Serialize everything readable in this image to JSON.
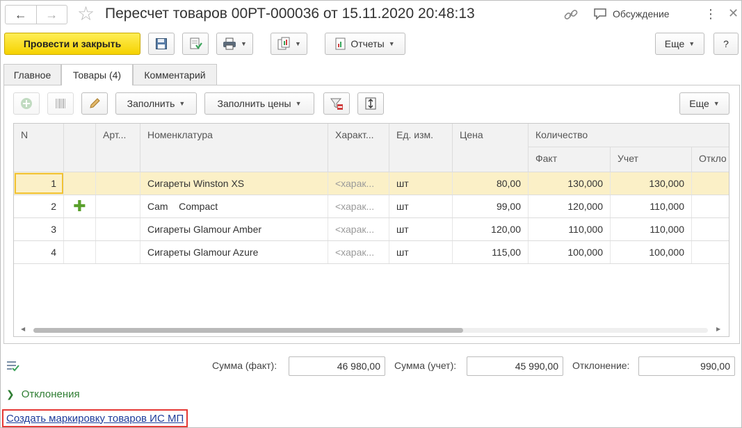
{
  "window": {
    "title": "Пересчет товаров 00РТ-000036 от 15.11.2020 20:48:13",
    "discussion_label": "Обсуждение"
  },
  "toolbar": {
    "post_close_label": "Провести и закрыть",
    "reports_label": "Отчеты",
    "more_label": "Еще",
    "help_label": "?"
  },
  "tabs": [
    {
      "label": "Главное",
      "active": false
    },
    {
      "label": "Товары (4)",
      "active": true
    },
    {
      "label": "Комментарий",
      "active": false
    }
  ],
  "items_toolbar": {
    "fill_label": "Заполнить",
    "fill_prices_label": "Заполнить цены",
    "more_label": "Еще"
  },
  "table": {
    "headers": {
      "n": "N",
      "article": "Арт...",
      "nomenclature": "Номенклатура",
      "characteristic": "Характ...",
      "unit": "Ед. изм.",
      "price": "Цена",
      "quantity": "Количество",
      "fact": "Факт",
      "account": "Учет",
      "deviation": "Откло"
    },
    "rows": [
      {
        "n": "1",
        "nomenclature": "Сигареты Winston XS",
        "characteristic": "<харак...",
        "unit": "шт",
        "price": "80,00",
        "fact": "130,000",
        "account": "130,000",
        "deviation": "",
        "added": false
      },
      {
        "n": "2",
        "nomenclature": "Cam    Compact",
        "characteristic": "<харак...",
        "unit": "шт",
        "price": "99,00",
        "fact": "120,000",
        "account": "110,000",
        "deviation": "",
        "added": true
      },
      {
        "n": "3",
        "nomenclature": "Сигареты Glamour Amber",
        "characteristic": "<харак...",
        "unit": "шт",
        "price": "120,00",
        "fact": "110,000",
        "account": "110,000",
        "deviation": "",
        "added": false
      },
      {
        "n": "4",
        "nomenclature": "Сигареты Glamour Azure",
        "characteristic": "<харак...",
        "unit": "шт",
        "price": "115,00",
        "fact": "100,000",
        "account": "100,000",
        "deviation": "",
        "added": false
      }
    ]
  },
  "totals": {
    "sum_fact_label": "Сумма (факт):",
    "sum_fact_value": "46 980,00",
    "sum_account_label": "Сумма (учет):",
    "sum_account_value": "45 990,00",
    "deviation_label": "Отклонение:",
    "deviation_value": "990,00"
  },
  "deviations_label": "Отклонения",
  "create_marking_link": "Создать маркировку товаров ИС МП",
  "colors": {
    "primary_button": "#f5d200",
    "selected_row": "#fbf0c7",
    "link": "#1e3c9a",
    "highlight_border": "#e53935",
    "group_link": "#2e7d32"
  }
}
